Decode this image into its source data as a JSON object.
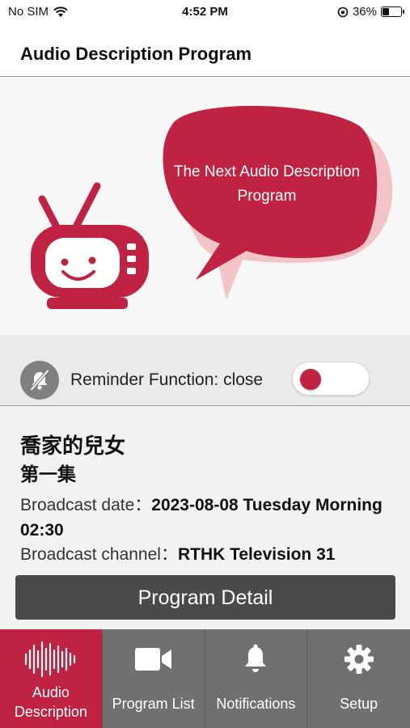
{
  "status_bar": {
    "carrier": "No SIM",
    "time": "4:52 PM",
    "battery_percent": "36%",
    "battery_level": 0.36
  },
  "header": {
    "title": "Audio Description Program"
  },
  "hero": {
    "bubble_line1": "The Next Audio Description",
    "bubble_line2": "Program",
    "colors": {
      "accent": "#c02342",
      "shadow": "#f2c4c6"
    }
  },
  "reminder": {
    "label": "Reminder Function: close",
    "enabled": false
  },
  "program": {
    "title": "喬家的兒女",
    "episode": "第一集",
    "date_label": "Broadcast date：",
    "date_value": "2023-08-08 Tuesday Morning 02:30",
    "channel_label": "Broadcast channel：",
    "channel_value": "RTHK Television 31",
    "detail_button": "Program Detail"
  },
  "tabs": [
    {
      "label": "Audio Description",
      "icon": "sound-wave-icon",
      "active": true
    },
    {
      "label": "Program List",
      "icon": "video-camera-icon",
      "active": false
    },
    {
      "label": "Notifications",
      "icon": "bell-icon",
      "active": false
    },
    {
      "label": "Setup",
      "icon": "gear-icon",
      "active": false
    }
  ]
}
